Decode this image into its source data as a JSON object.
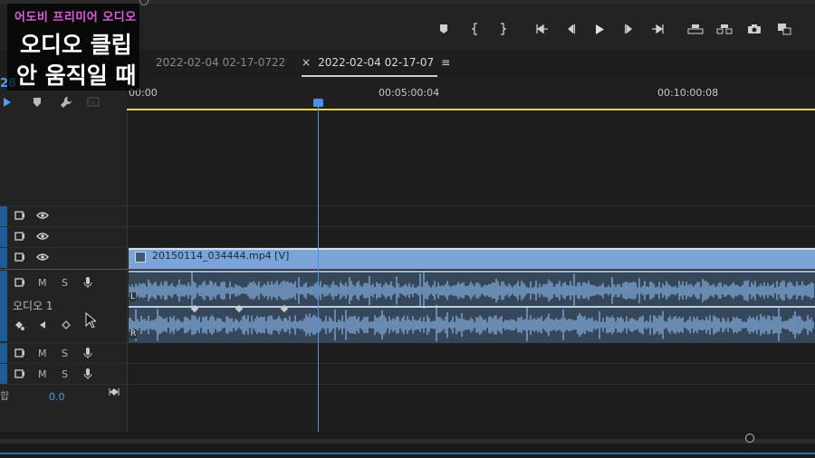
{
  "overlay": {
    "subtitle": "어도비 프리미어 오디오",
    "title_line1": "오디오 클립",
    "title_line2": "안 움직일 때"
  },
  "transport": {
    "buttons": [
      "add-marker",
      "mark-in",
      "mark-out",
      "go-to-in",
      "step-back",
      "play",
      "step-forward",
      "go-to-out",
      "lift",
      "extract",
      "export-frame",
      "button-editor"
    ]
  },
  "tabs": [
    {
      "label": "2022-02-04 02-17-0722",
      "active": false
    },
    {
      "label": "2022-02-04 02-17-07",
      "active": true,
      "close": "×",
      "menu": "≡"
    }
  ],
  "sequence": {
    "timecode_partial": "28",
    "ruler": [
      "00:00",
      "00:05:00:04",
      "00:10:00:08"
    ]
  },
  "tracks": {
    "video_clip_name": "20150114_034444.mp4 [V]",
    "audio_track_name": "오디오 1",
    "mute_label": "M",
    "solo_label": "S",
    "left_label": "L",
    "right_label": "R",
    "mix_label": "합",
    "mix_value": "0.0"
  },
  "colors": {
    "accent": "#4a8fe8",
    "video_clip": "#7ba5d8",
    "audio_clip": "#36475a",
    "waveform": "#7fa8d6",
    "work_area": "#e8d63a",
    "overlay_subtitle": "#e05ae0"
  }
}
